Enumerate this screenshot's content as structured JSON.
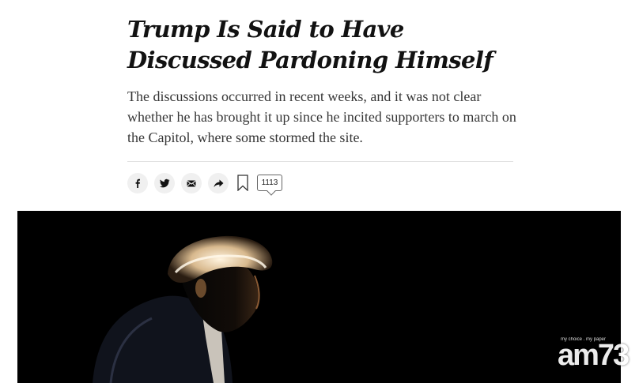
{
  "article": {
    "headline": "Trump Is Said to Have Discussed Pardoning Himself",
    "summary": "The discussions occurred in recent weeks, and it was not clear whether he has brought it up since he incited supporters to march on the Capitol, where some stormed the site."
  },
  "share_bar": {
    "buttons": [
      "facebook-icon",
      "twitter-icon",
      "email-icon",
      "share-icon"
    ],
    "bookmark_icon": "bookmark-icon",
    "comment_count": "1113"
  },
  "watermark": {
    "tagline": "my choice . my paper",
    "logo": "am73"
  },
  "colors": {
    "headline": "#121212",
    "summary": "#363636",
    "icon_bg": "#f0f0f0",
    "photo_bg": "#000000"
  }
}
